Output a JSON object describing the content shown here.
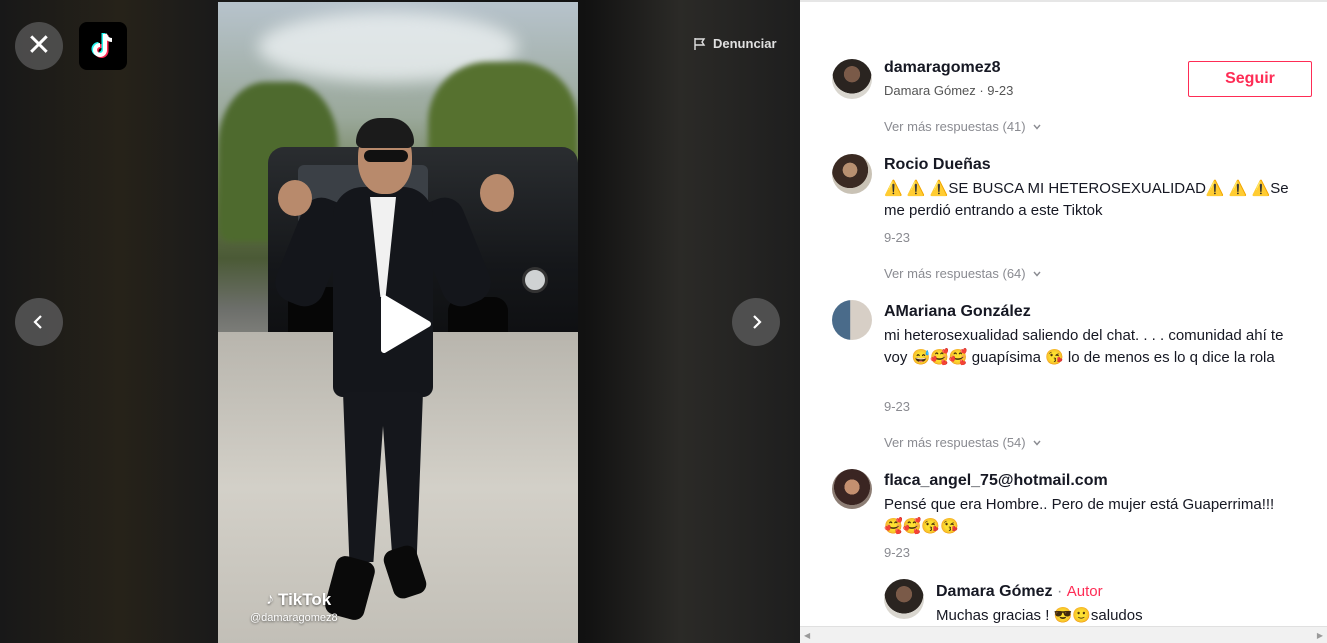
{
  "video": {
    "close_icon": "close-icon",
    "logo_icon": "tiktok-logo-icon",
    "report_label": "Denunciar",
    "report_icon": "flag-icon",
    "prev_icon": "chevron-left-icon",
    "next_icon": "chevron-right-icon",
    "play_icon": "play-icon",
    "watermark_brand": "TikTok",
    "watermark_user": "@damaragomez8"
  },
  "author": {
    "username": "damaragomez8",
    "subtitle": "Damara Gómez · 9-23",
    "follow_label": "Seguir"
  },
  "comments": [
    {
      "more_replies": "Ver más respuestas (41)",
      "name": "Rocio Dueñas",
      "text": "⚠️ ⚠️ ⚠️SE BUSCA MI HETEROSEXUALIDAD⚠️ ⚠️ ⚠️Se me perdió entrando a este Tiktok",
      "date": "9-23"
    },
    {
      "more_replies": "Ver más respuestas (64)",
      "name": "AMariana González",
      "text": "mi heterosexualidad saliendo del chat. . . . comunidad ahí te voy 😅🥰🥰 guapísima 😘 lo de menos es lo q dice la rola",
      "date": "9-23"
    },
    {
      "more_replies": "Ver más respuestas (54)",
      "name": "flaca_angel_75@hotmail.com",
      "text": "Pensé que era Hombre.. Pero de mujer está Guaperrima!!! 🥰🥰😘😘",
      "date": "9-23"
    }
  ],
  "reply": {
    "name": "Damara Gómez",
    "separator": "·",
    "author_tag": "Autor",
    "text": "Muchas gracias ! 😎🙂saludos"
  },
  "colors": {
    "accent": "#fe2c55",
    "text": "#161823",
    "muted": "#8a8b91"
  }
}
